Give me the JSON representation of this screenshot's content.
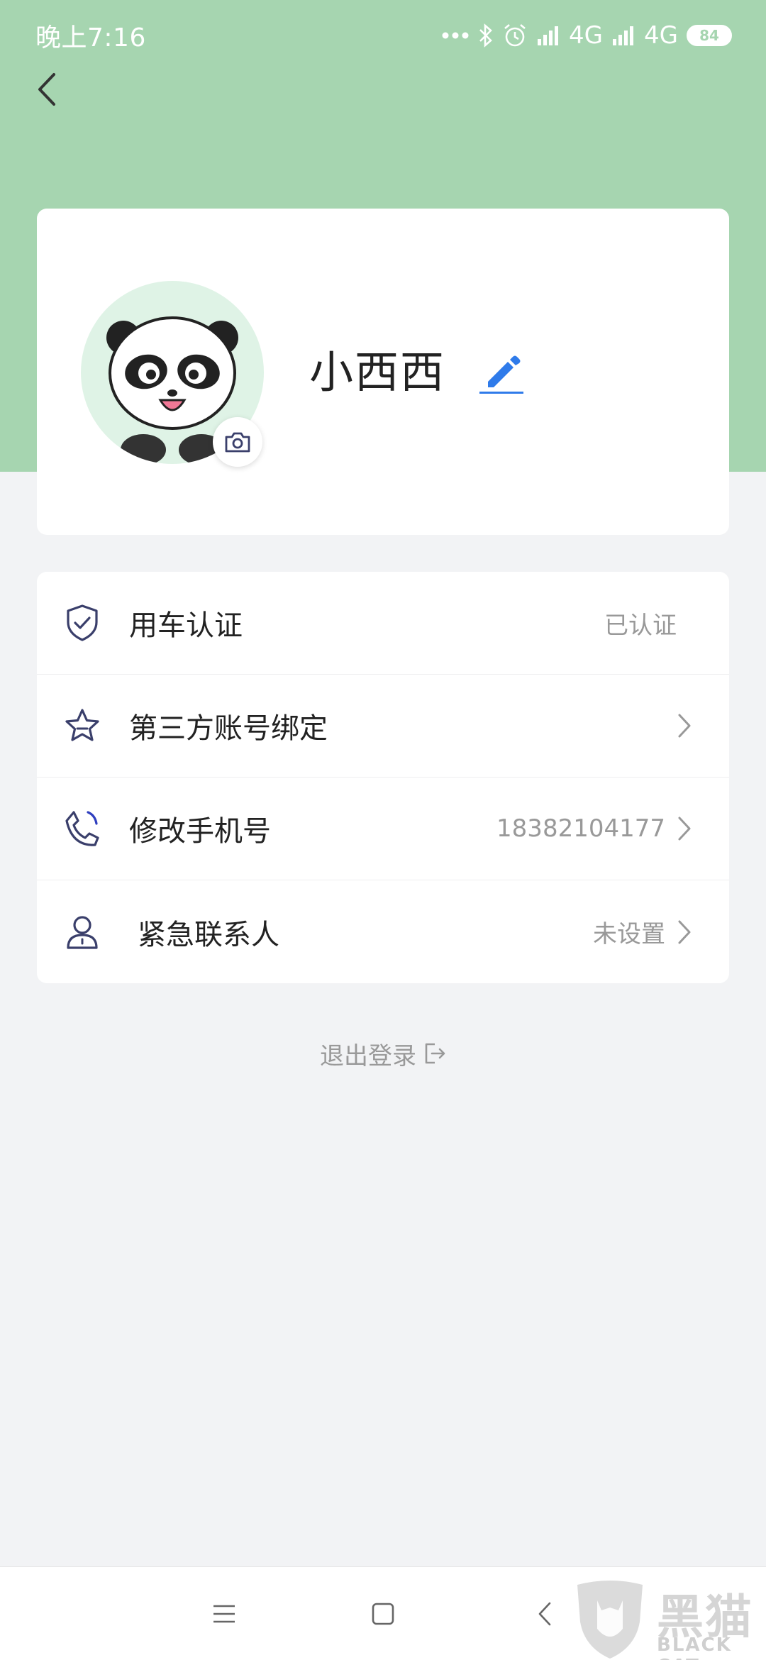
{
  "status_bar": {
    "time": "晚上7:16",
    "network1": "4G",
    "network2": "4G",
    "battery": "84"
  },
  "profile": {
    "nickname": "小西西"
  },
  "menu": [
    {
      "label": "用车认证",
      "value": "已认证",
      "icon": "shield-check-icon"
    },
    {
      "label": "第三方账号绑定",
      "value": "",
      "icon": "star-icon"
    },
    {
      "label": "修改手机号",
      "value": "18382104177",
      "icon": "phone-icon"
    },
    {
      "label": "紧急联系人",
      "value": "未设置",
      "icon": "person-icon"
    }
  ],
  "logout": {
    "label": "退出登录"
  },
  "watermark": {
    "text": "黑猫",
    "sub": "BLACK CAT"
  },
  "colors": {
    "header": "#a6d5b0",
    "accent": "#2f7bea",
    "background": "#f2f3f5"
  }
}
